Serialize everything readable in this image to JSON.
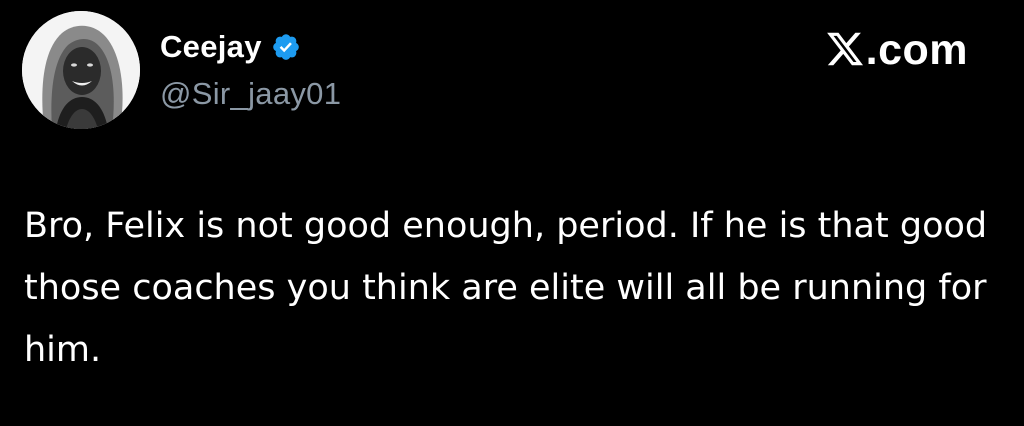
{
  "post": {
    "author": {
      "display_name": "Ceejay",
      "handle": "@Sir_jaay01",
      "verified": true,
      "avatar_icon": "profile-photo"
    },
    "brand": {
      "text": ".com",
      "logo_icon": "x-logo-icon"
    },
    "body": "Bro, Felix is not good enough, period. If he is that good those coaches you think are elite will all be running for him."
  },
  "colors": {
    "background": "#000000",
    "text_primary": "#ffffff",
    "text_secondary": "#8b98a5",
    "verified_badge": "#1d9bf0"
  }
}
